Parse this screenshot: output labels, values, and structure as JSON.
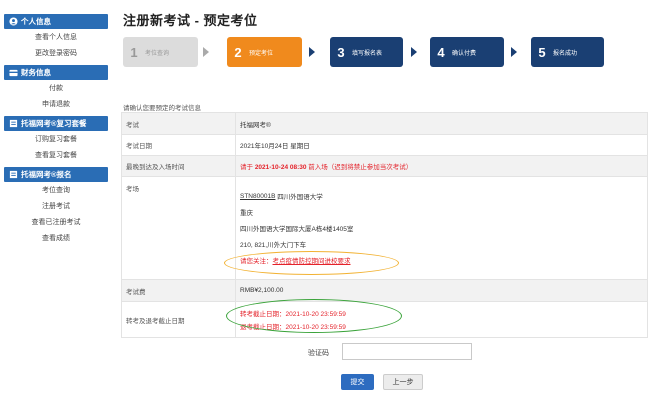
{
  "sidebar": {
    "sections": [
      {
        "title": "个人信息",
        "icon": "user-circle-icon",
        "items": [
          "查看个人信息",
          "更改登录密码"
        ]
      },
      {
        "title": "财务信息",
        "icon": "card-icon",
        "items": [
          "付款",
          "申请退款"
        ]
      },
      {
        "title": "托福网考®复习套餐",
        "icon": "book-icon",
        "items": [
          "订购复习套餐",
          "查看复习套餐"
        ]
      },
      {
        "title": "托福网考®报名",
        "icon": "book-icon",
        "items": [
          "考位查询",
          "注册考试",
          "查看已注册考试",
          "查看成绩"
        ]
      }
    ]
  },
  "page_title": "注册新考试 - 预定考位",
  "steps": [
    {
      "num": "1",
      "label": "考位查询",
      "state": "done"
    },
    {
      "num": "2",
      "label": "预定考位",
      "state": "active"
    },
    {
      "num": "3",
      "label": "填写报名表",
      "state": "todo"
    },
    {
      "num": "4",
      "label": "确认付费",
      "state": "todo"
    },
    {
      "num": "5",
      "label": "报名成功",
      "state": "todo"
    }
  ],
  "note": "请确认您要预定的考试信息",
  "table": {
    "exam": {
      "key": "考试",
      "value": "托福网考®"
    },
    "date": {
      "key": "考试日期",
      "value": "2021年10月24日 星期日"
    },
    "arrival": {
      "key": "最晚到达及入场时间",
      "prefix": "请于 ",
      "time": "2021-10-24 08:30",
      "suffix": " 前入场（迟到将禁止参加当次考试）"
    },
    "venue": {
      "key": "考场",
      "code": "STN80001B",
      "name": "四川外国语大学",
      "city": "重庆",
      "address": "四川外国语大学国际大厦A栋4楼1405室",
      "transport": "210, 821,川外大门下车",
      "notice_label": "请您关注：",
      "notice_link": "考点疫情防控期间进校要求"
    },
    "fee": {
      "key": "考试费",
      "value": "RMB¥2,100.00"
    },
    "deadline": {
      "key": "转考及退考截止日期",
      "transfer": "转考截止日期：2021-10-20 23:59:59",
      "refund": "退考截止日期：2021-10-20 23:59:59"
    }
  },
  "captcha": {
    "label": "验证码",
    "value": ""
  },
  "buttons": {
    "submit": "提交",
    "prev": "上一步"
  },
  "colors": {
    "sidebar_header": "#2a6db5",
    "step_active": "#f08a1d",
    "step_todo": "#1a3f73",
    "step_done": "#dcdcdc",
    "alert_red": "#e4222a",
    "submit": "#2d6cc0"
  }
}
